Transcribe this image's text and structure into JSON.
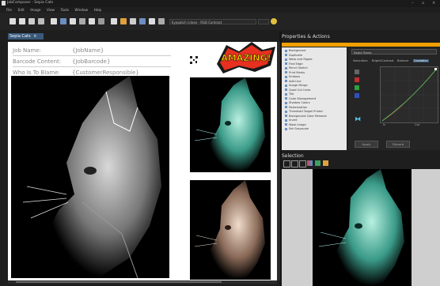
{
  "window": {
    "title": "JobComposer - Sepia Cats"
  },
  "menu": [
    "File",
    "Edit",
    "Image",
    "View",
    "Tools",
    "Window",
    "Help"
  ],
  "toolbar": {
    "dropdown1": "Eyepatch (clean - RGB Contrast",
    "dropdown2": ""
  },
  "document": {
    "tab_label": "Sepia Cats",
    "fields": [
      {
        "label": "Job Name:",
        "value": "{JobName}"
      },
      {
        "label": "Barcode Content:",
        "value": "{JobBarcode}"
      },
      {
        "label": "Who Is To Blame:",
        "value": "{CustomerResponsible}"
      }
    ],
    "logo_text": "AMAZING!"
  },
  "panel": {
    "title": "Properties & Actions",
    "actions": [
      "Background",
      "Duplicate",
      "Warp and Ripple",
      "Find Edge",
      "Pencil Sketch",
      "Print Marks",
      "Emboss",
      "Add Line",
      "Image Merge",
      "Quad Cut Lines",
      "Tile",
      "Color Management",
      "Shadow Colors",
      "Posterization",
      "Threshold Target Printer",
      "Background Color Remove",
      "Invert",
      "Mask Image",
      "Set Grayscale"
    ],
    "fx_select": "Sepia Tones",
    "fx_tabs": [
      "Saturation",
      "Bright/Contrast",
      "Balance",
      "Gradation"
    ],
    "graph_labels": [
      "In",
      "Out"
    ],
    "buttons": [
      "Apply",
      "Discard"
    ]
  },
  "selection": {
    "title": "Selection"
  },
  "colors": {
    "accent": "#f0a000",
    "tab": "#3a5a7a",
    "teal": "#4fbfa8",
    "sepia": "#c9a48a"
  }
}
